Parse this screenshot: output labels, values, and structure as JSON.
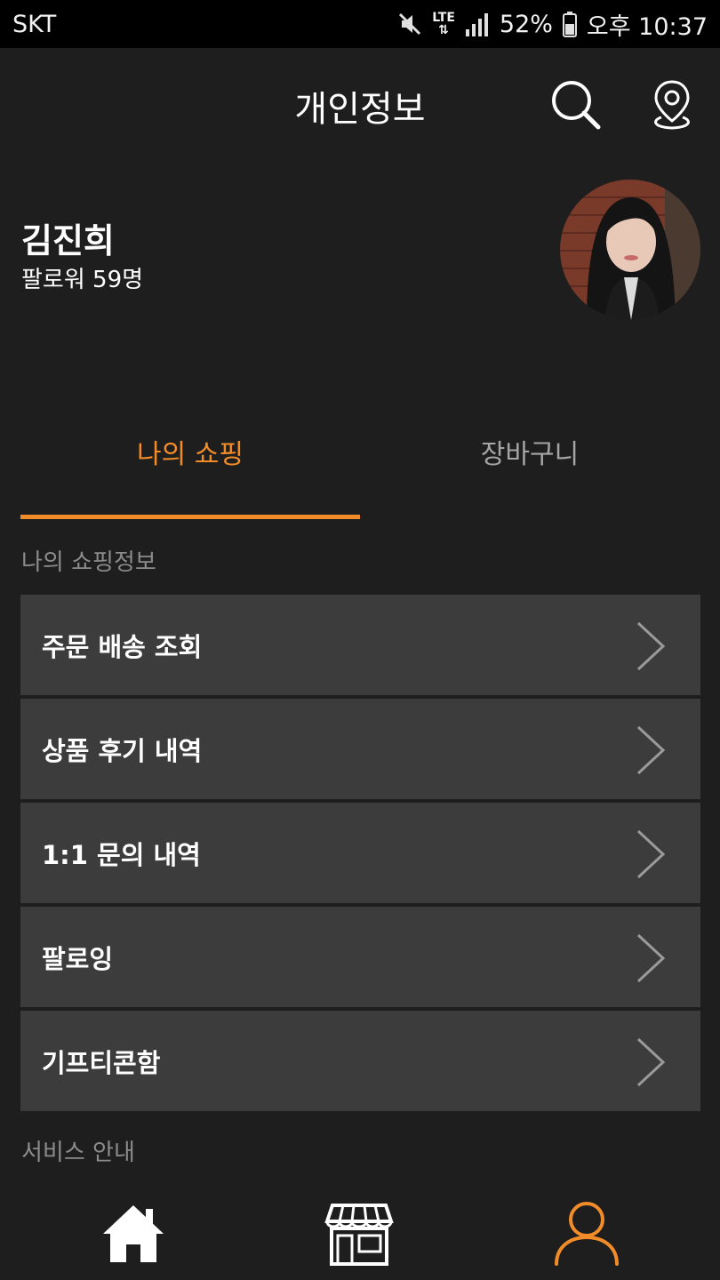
{
  "status_bar": {
    "carrier": "SKT",
    "network": "LTE",
    "battery": "52%",
    "time": "오후 10:37",
    "icons": [
      "mute-icon",
      "lte-icon",
      "signal-icon",
      "battery-icon"
    ]
  },
  "header": {
    "title": "개인정보",
    "icons": [
      "search-icon",
      "location-pin-icon"
    ]
  },
  "profile": {
    "name": "김진희",
    "followers": "팔로워 59명"
  },
  "tabs": [
    {
      "label": "나의 쇼핑",
      "active": true
    },
    {
      "label": "장바구니",
      "active": false
    }
  ],
  "sections": {
    "shopping_info": "나의 쇼핑정보",
    "service_info": "서비스 안내"
  },
  "menu": [
    {
      "label": "주문 배송 조회"
    },
    {
      "label": "상품 후기 내역"
    },
    {
      "label": "1:1 문의 내역"
    },
    {
      "label": "팔로잉"
    },
    {
      "label": "기프티콘함"
    }
  ],
  "bottom_nav": {
    "items": [
      "home-icon",
      "store-icon",
      "profile-icon"
    ],
    "active": "profile-icon"
  },
  "colors": {
    "accent": "#f28c28",
    "background": "#1e1e1e",
    "card": "#3c3c3c",
    "muted_text": "#8c8c8c"
  }
}
